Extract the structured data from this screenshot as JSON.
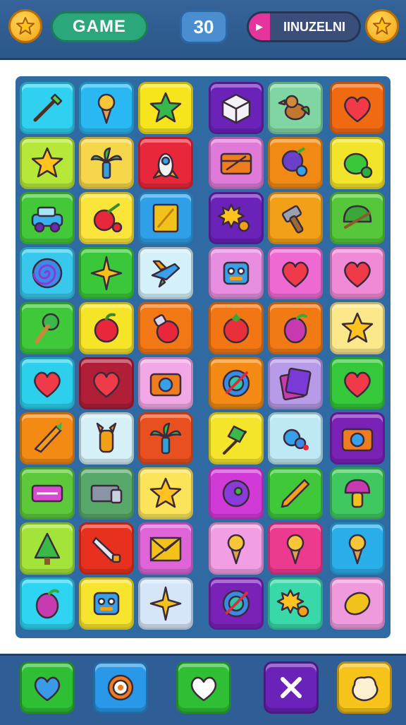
{
  "header": {
    "game_label": "GAME",
    "score": "30",
    "level_label": "IINUZELNI",
    "left_coin_icon": "star-icon",
    "right_coin_icon": "star-icon"
  },
  "board": {
    "rows": 10,
    "cols": 6,
    "tiles": [
      {
        "bg": "#2fd0f0",
        "icon": "brush"
      },
      {
        "bg": "#29b8f2",
        "icon": "ice-cream"
      },
      {
        "bg": "#f6e41c",
        "icon": "leaf-star"
      },
      {
        "bg": "#6a22b8",
        "icon": "cube"
      },
      {
        "bg": "#7fd6a2",
        "icon": "bird"
      },
      {
        "bg": "#f06a12",
        "icon": "heart"
      },
      {
        "bg": "#b6e83a",
        "icon": "star"
      },
      {
        "bg": "#f6d64a",
        "icon": "palm-leaf"
      },
      {
        "bg": "#e8283a",
        "icon": "rocket"
      },
      {
        "bg": "#e07ad8",
        "icon": "chest"
      },
      {
        "bg": "#f08a14",
        "icon": "blueberry"
      },
      {
        "bg": "#f2e42a",
        "icon": "lime"
      },
      {
        "bg": "#44c83a",
        "icon": "car"
      },
      {
        "bg": "#fbe53a",
        "icon": "cherry"
      },
      {
        "bg": "#2f9fe8",
        "icon": "card"
      },
      {
        "bg": "#6a22b8",
        "icon": "gear-sun"
      },
      {
        "bg": "#f2a018",
        "icon": "hammer"
      },
      {
        "bg": "#56c63a",
        "icon": "helmet"
      },
      {
        "bg": "#38c8ec",
        "icon": "spiral"
      },
      {
        "bg": "#3ac83a",
        "icon": "sparkle"
      },
      {
        "bg": "#d4f0f8",
        "icon": "plane"
      },
      {
        "bg": "#e78ee0",
        "icon": "robot"
      },
      {
        "bg": "#ee6ad2",
        "icon": "heart"
      },
      {
        "bg": "#f08ad6",
        "icon": "heart"
      },
      {
        "bg": "#3ec83a",
        "icon": "broccoli"
      },
      {
        "bg": "#f6e428",
        "icon": "apple"
      },
      {
        "bg": "#f27816",
        "icon": "bomb"
      },
      {
        "bg": "#f27614",
        "icon": "tomato"
      },
      {
        "bg": "#f27a14",
        "icon": "plum"
      },
      {
        "bg": "#fbe88a",
        "icon": "star"
      },
      {
        "bg": "#2cd0ec",
        "icon": "heart"
      },
      {
        "bg": "#b01e38",
        "icon": "heart"
      },
      {
        "bg": "#f2a8e6",
        "icon": "camera"
      },
      {
        "bg": "#f28a14",
        "icon": "target"
      },
      {
        "bg": "#b79ae8",
        "icon": "book"
      },
      {
        "bg": "#34c83a",
        "icon": "heart"
      },
      {
        "bg": "#f28a14",
        "icon": "carrot"
      },
      {
        "bg": "#d6f0f8",
        "icon": "giraffe"
      },
      {
        "bg": "#e85020",
        "icon": "palm-leaf"
      },
      {
        "bg": "#f4e42a",
        "icon": "flag"
      },
      {
        "bg": "#bde8f4",
        "icon": "grapes"
      },
      {
        "bg": "#7a22b6",
        "icon": "camera"
      },
      {
        "bg": "#5cc83a",
        "icon": "sign"
      },
      {
        "bg": "#58a86a",
        "icon": "box"
      },
      {
        "bg": "#fbe45a",
        "icon": "star"
      },
      {
        "bg": "#d23ad8",
        "icon": "donut"
      },
      {
        "bg": "#3ec83a",
        "icon": "pencil"
      },
      {
        "bg": "#40c860",
        "icon": "mushroom"
      },
      {
        "bg": "#a4e43a",
        "icon": "tree"
      },
      {
        "bg": "#e8301e",
        "icon": "knife"
      },
      {
        "bg": "#de64d8",
        "icon": "envelope"
      },
      {
        "bg": "#f29ee4",
        "icon": "ice-cream"
      },
      {
        "bg": "#ec3a8e",
        "icon": "ice-cream"
      },
      {
        "bg": "#2aaeea",
        "icon": "ice-cream"
      },
      {
        "bg": "#2ed4f2",
        "icon": "plum"
      },
      {
        "bg": "#f6e42e",
        "icon": "robot"
      },
      {
        "bg": "#d6e6f8",
        "icon": "sparkle"
      },
      {
        "bg": "#7a22b8",
        "icon": "target"
      },
      {
        "bg": "#38d8a8",
        "icon": "gear-sun"
      },
      {
        "bg": "#f09ade",
        "icon": "lemon"
      }
    ]
  },
  "powerups": [
    {
      "name": "heart-powerup",
      "bg": "#2fbf35",
      "icon": "heart-blue"
    },
    {
      "name": "ring-powerup",
      "bg": "#2a98e8",
      "icon": "ring"
    },
    {
      "name": "heart-outline-powerup",
      "bg": "#2fbf35",
      "icon": "heart-white"
    },
    {
      "name": "cross-powerup",
      "bg": "#6a22b8",
      "icon": "cross"
    },
    {
      "name": "cookie-powerup",
      "bg": "#f6c31a",
      "icon": "cookie"
    }
  ],
  "colors": {
    "topbar": "#2f5e97",
    "board": "#2f6aa3",
    "accent_green": "#2aa77b",
    "accent_pink": "#e5359c"
  }
}
